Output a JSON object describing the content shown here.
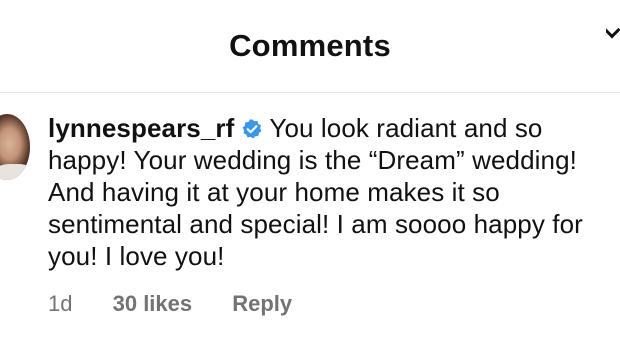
{
  "header": {
    "title": "Comments",
    "chevron_icon": "chevron-down-icon"
  },
  "comment": {
    "username": "lynnespears_rf",
    "verified_icon": "verified-badge-icon",
    "verified_color": "#3897f0",
    "text": "You look radiant and so happy! Your wedding is the “Dream” wedding! And having it at your home makes it so sentimental and special! I am soooo happy for you! I love you!",
    "time": "1d",
    "likes": "30 likes",
    "reply_label": "Reply"
  }
}
